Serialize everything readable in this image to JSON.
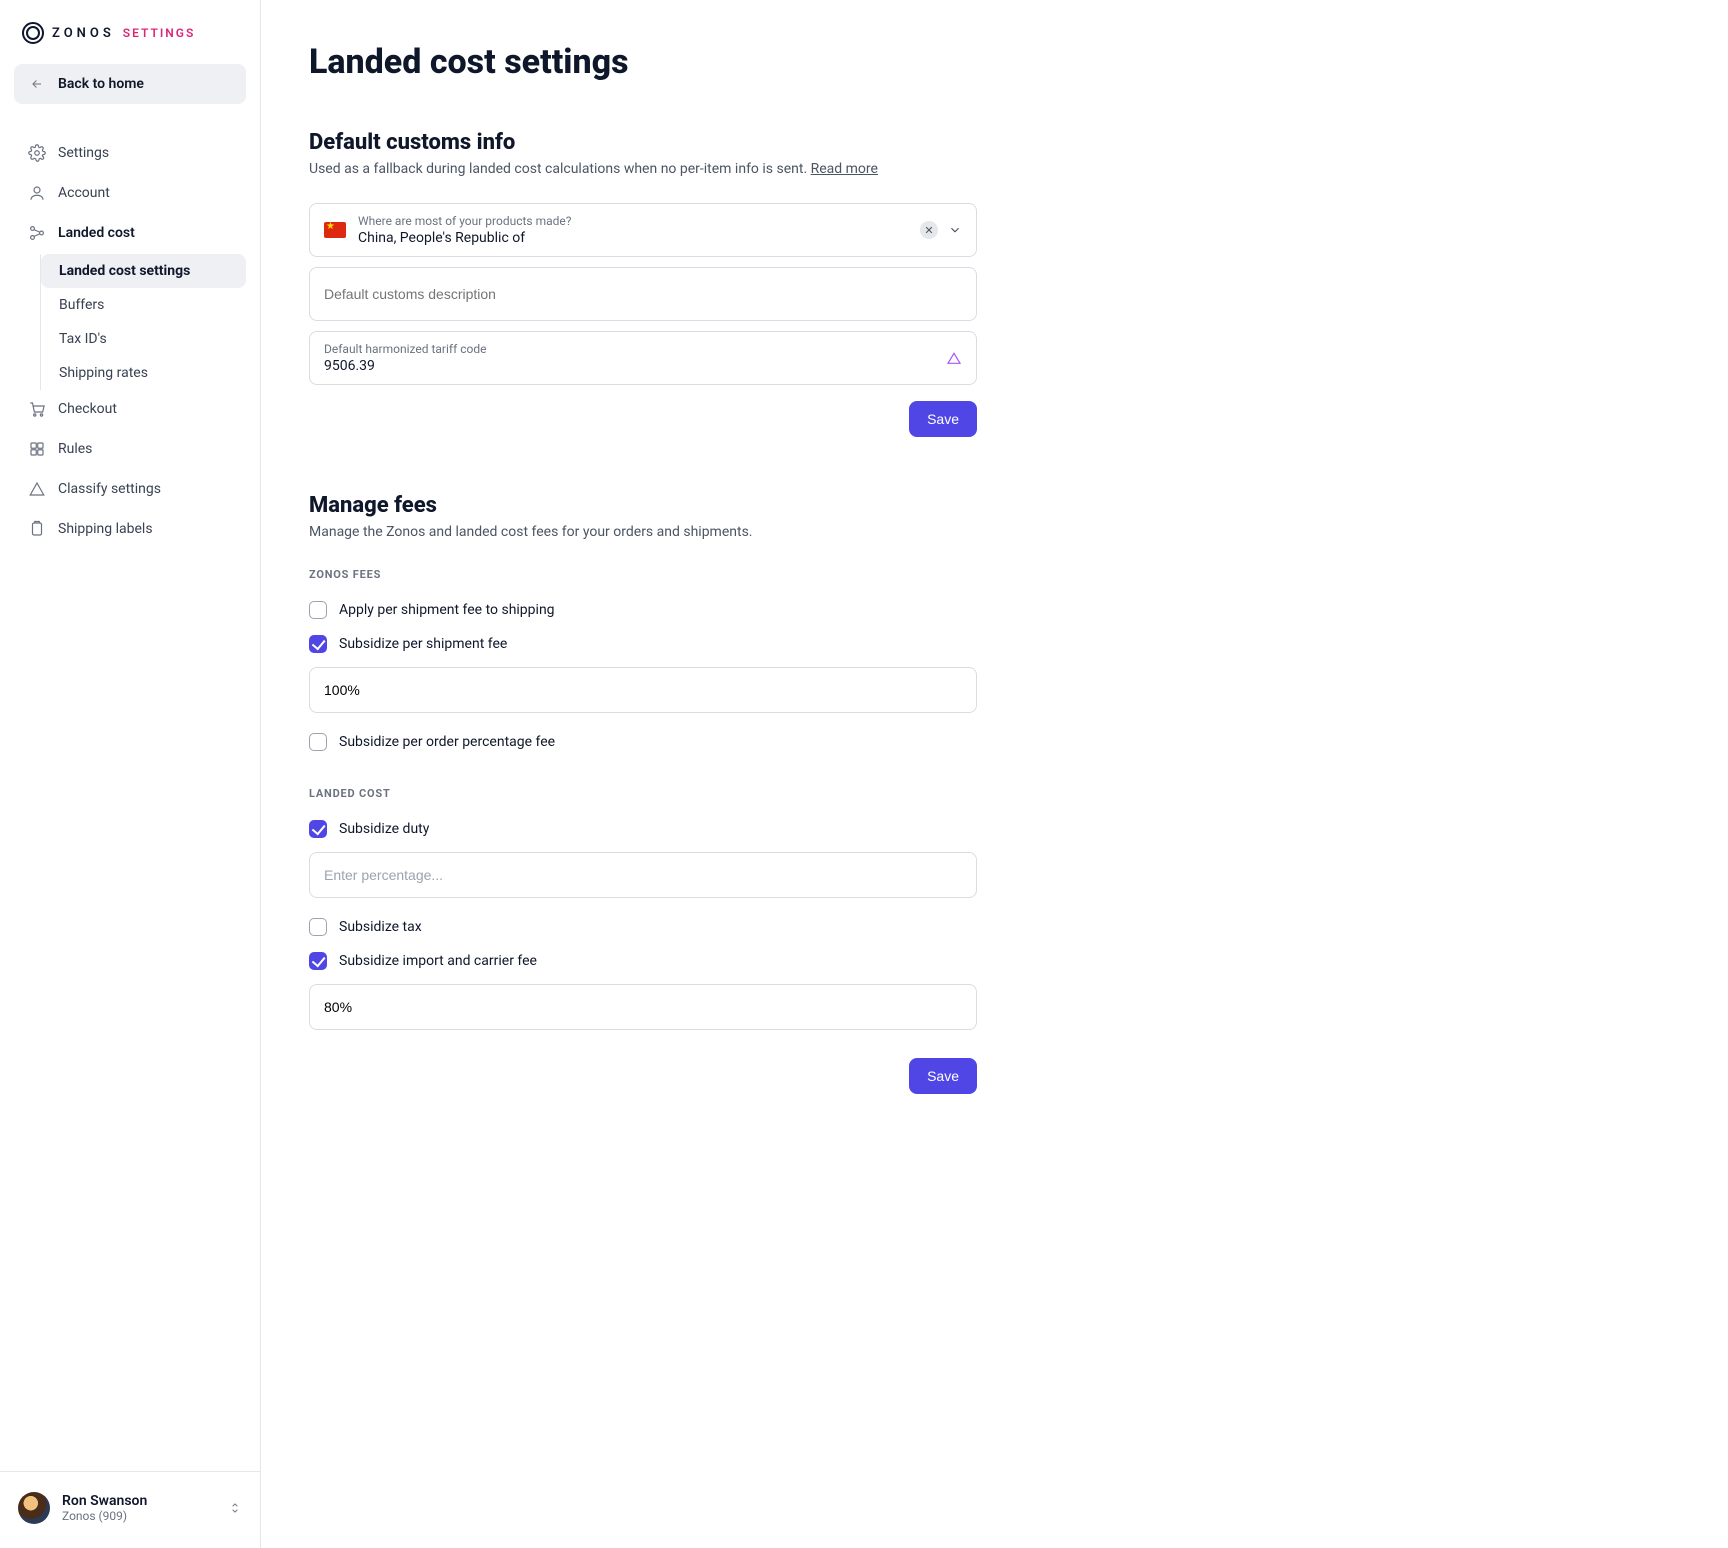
{
  "brand": {
    "name": "ZONOS",
    "section": "SETTINGS"
  },
  "sidebar": {
    "back": "Back to home",
    "items": [
      {
        "label": "Settings"
      },
      {
        "label": "Account"
      },
      {
        "label": "Landed cost"
      },
      {
        "label": "Checkout"
      },
      {
        "label": "Rules"
      },
      {
        "label": "Classify settings"
      },
      {
        "label": "Shipping labels"
      }
    ],
    "landed_sub": [
      {
        "label": "Landed cost settings"
      },
      {
        "label": "Buffers"
      },
      {
        "label": "Tax ID's"
      },
      {
        "label": "Shipping rates"
      }
    ]
  },
  "user": {
    "name": "Ron Swanson",
    "org": "Zonos (909)"
  },
  "page": {
    "title": "Landed cost settings",
    "customs": {
      "heading": "Default customs info",
      "sub_prefix": "Used as a fallback during landed cost calculations when no per-item info is sent. ",
      "read_more": "Read more",
      "origin_label": "Where are most of your products made?",
      "origin_value": "China, People's Republic of",
      "description_placeholder": "Default customs description",
      "tariff_label": "Default harmonized tariff code",
      "tariff_value": "9506.39",
      "save": "Save"
    },
    "fees": {
      "heading": "Manage fees",
      "sub": "Manage the Zonos and landed cost fees for your orders and shipments.",
      "zonos_head": "ZONOS FEES",
      "zonos": [
        {
          "label": "Apply per shipment fee to shipping",
          "checked": false
        },
        {
          "label": "Subsidize per shipment fee",
          "checked": true,
          "value": "100%"
        },
        {
          "label": "Subsidize per order percentage fee",
          "checked": false
        }
      ],
      "landed_head": "LANDED COST",
      "landed": [
        {
          "label": "Subsidize duty",
          "checked": true,
          "placeholder": "Enter percentage..."
        },
        {
          "label": "Subsidize tax",
          "checked": false
        },
        {
          "label": "Subsidize import and carrier fee",
          "checked": true,
          "value": "80%"
        }
      ],
      "save": "Save"
    }
  }
}
